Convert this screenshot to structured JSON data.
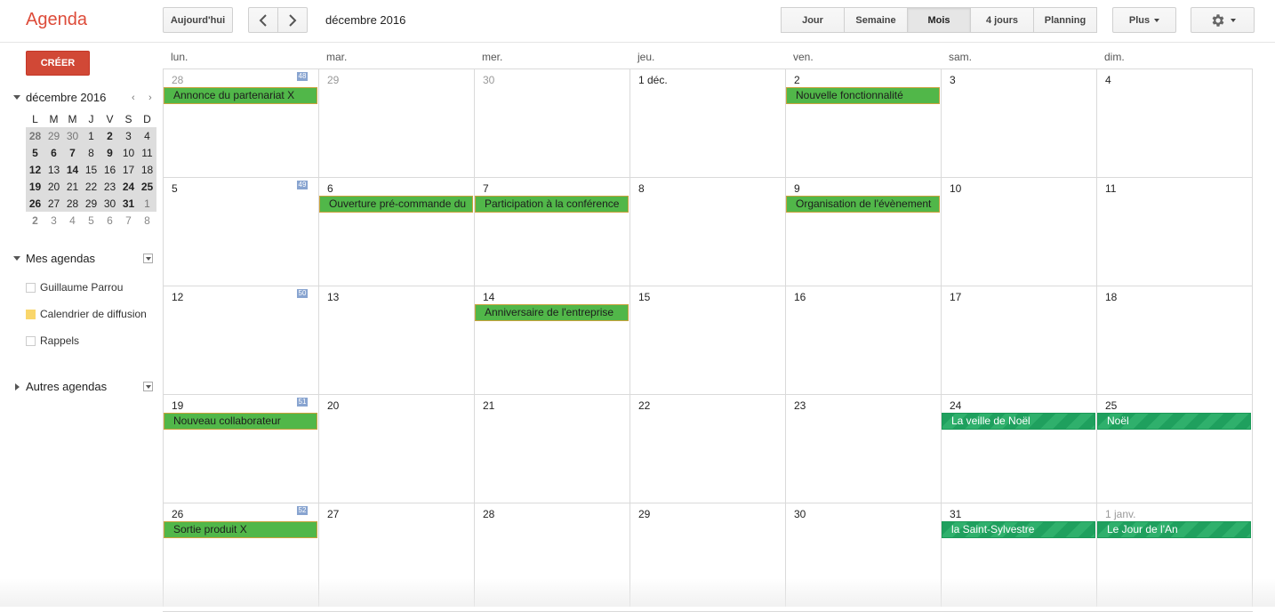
{
  "app": {
    "title": "Agenda"
  },
  "toolbar": {
    "today": "Aujourd'hui",
    "current_range": "décembre 2016",
    "views": [
      "Jour",
      "Semaine",
      "Mois",
      "4 jours",
      "Planning"
    ],
    "active_view": "Mois",
    "more": "Plus"
  },
  "sidebar": {
    "create": "CRÉER",
    "mini_title": "décembre 2016",
    "mini_prev": "‹",
    "mini_next": "›",
    "weekdays": [
      "L",
      "M",
      "M",
      "J",
      "V",
      "S",
      "D"
    ],
    "weeks": [
      [
        "28",
        "29",
        "30",
        "1",
        "2",
        "3",
        "4"
      ],
      [
        "5",
        "6",
        "7",
        "8",
        "9",
        "10",
        "11"
      ],
      [
        "12",
        "13",
        "14",
        "15",
        "16",
        "17",
        "18"
      ],
      [
        "19",
        "20",
        "21",
        "22",
        "23",
        "24",
        "25"
      ],
      [
        "26",
        "27",
        "28",
        "29",
        "30",
        "31",
        "1"
      ],
      [
        "2",
        "3",
        "4",
        "5",
        "6",
        "7",
        "8"
      ]
    ],
    "my_calendars_title": "Mes agendas",
    "my_calendars": [
      {
        "name": "Guillaume Parrou",
        "color": "#ffffff"
      },
      {
        "name": "Calendrier de diffusion",
        "color": "#f9d66b"
      },
      {
        "name": "Rappels",
        "color": "#ffffff"
      }
    ],
    "other_calendars_title": "Autres agendas"
  },
  "grid": {
    "day_headers": [
      "lun.",
      "mar.",
      "mer.",
      "jeu.",
      "ven.",
      "sam.",
      "dim."
    ],
    "weeks": [
      {
        "week_number": "48",
        "days": [
          "28",
          "29",
          "30",
          "1 déc.",
          "2",
          "3",
          "4"
        ]
      },
      {
        "week_number": "49",
        "days": [
          "5",
          "6",
          "7",
          "8",
          "9",
          "10",
          "11"
        ]
      },
      {
        "week_number": "50",
        "days": [
          "12",
          "13",
          "14",
          "15",
          "16",
          "17",
          "18"
        ]
      },
      {
        "week_number": "51",
        "days": [
          "19",
          "20",
          "21",
          "22",
          "23",
          "24",
          "25"
        ]
      },
      {
        "week_number": "52",
        "days": [
          "26",
          "27",
          "28",
          "29",
          "30",
          "31",
          "1 janv."
        ]
      }
    ],
    "events": [
      {
        "title": "Annonce du partenariat X",
        "week": 0,
        "day": 0,
        "kind": "event"
      },
      {
        "title": "Nouvelle fonctionnalité",
        "week": 0,
        "day": 4,
        "kind": "event"
      },
      {
        "title": "Ouverture pré-commande du",
        "week": 1,
        "day": 1,
        "kind": "event"
      },
      {
        "title": "Participation à la conférence",
        "week": 1,
        "day": 2,
        "kind": "event"
      },
      {
        "title": "Organisation de l'évènement",
        "week": 1,
        "day": 4,
        "kind": "event"
      },
      {
        "title": "Anniversaire de l'entreprise",
        "week": 2,
        "day": 2,
        "kind": "event"
      },
      {
        "title": "Nouveau collaborateur",
        "week": 3,
        "day": 0,
        "kind": "event"
      },
      {
        "title": "La veille de Noël",
        "week": 3,
        "day": 5,
        "kind": "holiday"
      },
      {
        "title": "Noël",
        "week": 3,
        "day": 6,
        "kind": "holiday"
      },
      {
        "title": "Sortie produit X",
        "week": 4,
        "day": 0,
        "kind": "event"
      },
      {
        "title": "la Saint-Sylvestre",
        "week": 4,
        "day": 5,
        "kind": "holiday"
      },
      {
        "title": "Le Jour de l'An",
        "week": 4,
        "day": 6,
        "kind": "holiday"
      }
    ]
  },
  "colors": {
    "event": "#51b749",
    "holiday": "#1fa05e",
    "create": "#d14836",
    "logo": "#dd4b39"
  }
}
